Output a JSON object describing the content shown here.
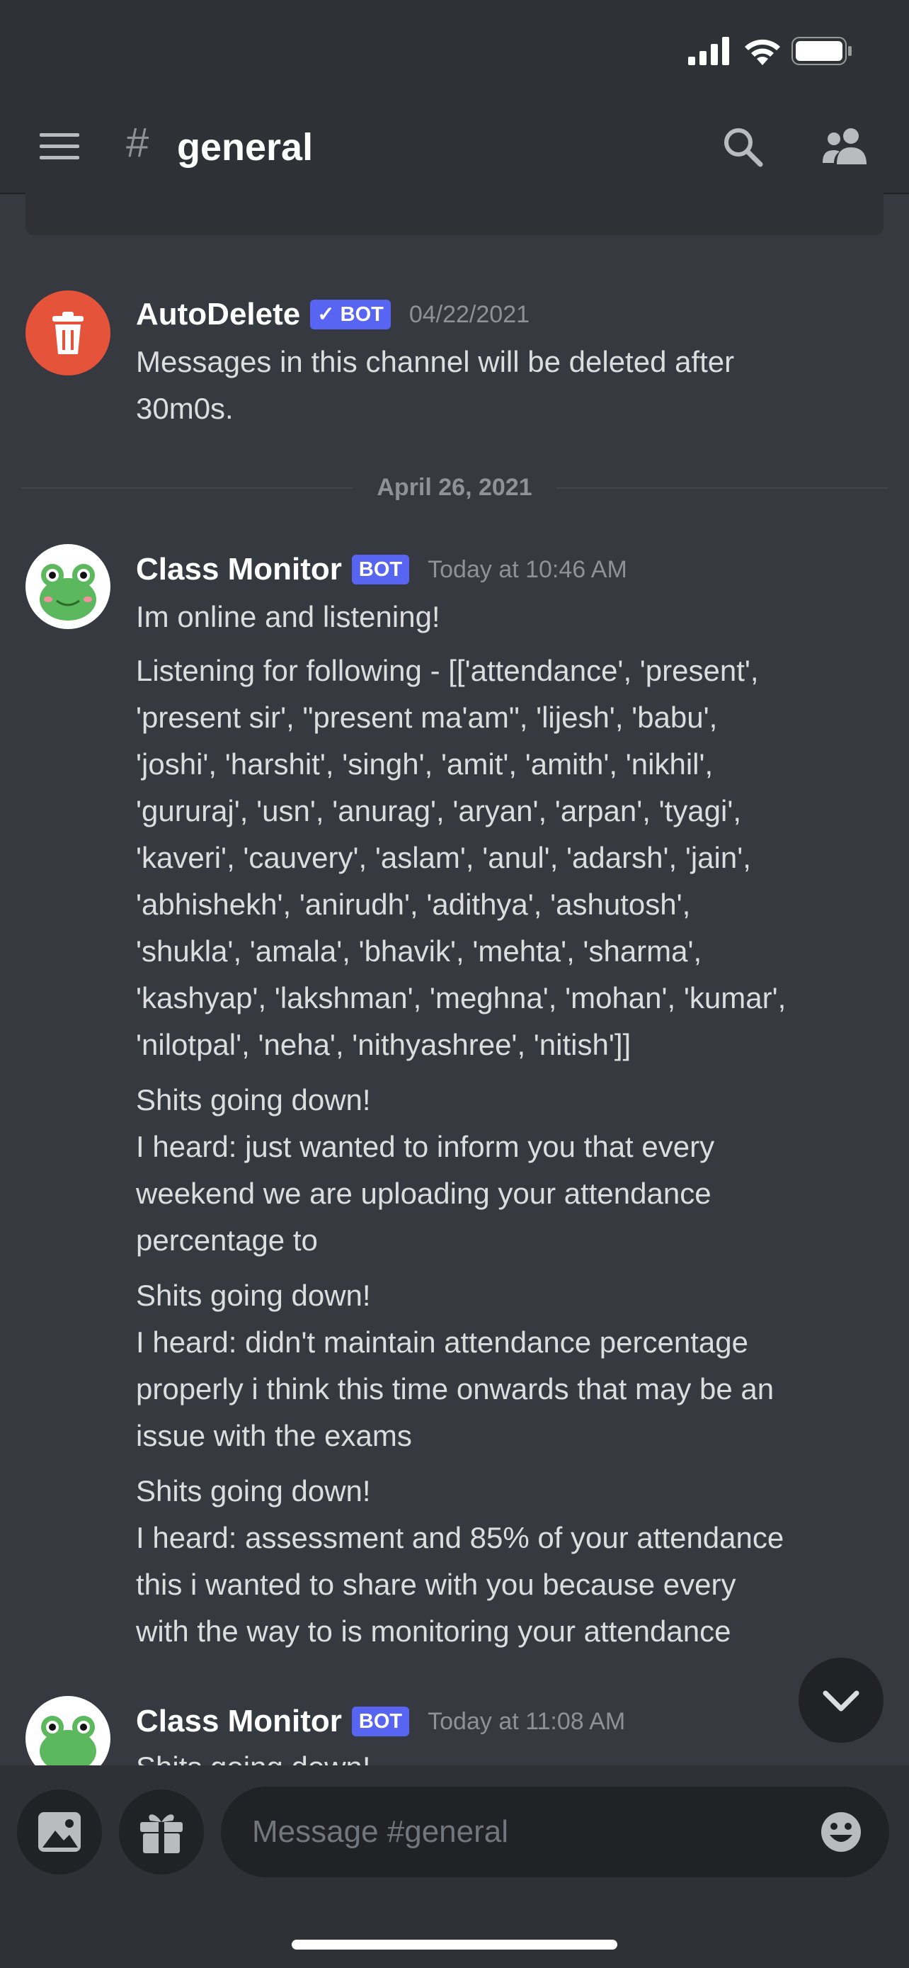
{
  "header": {
    "channel_name": "general",
    "hash_symbol": "#",
    "icons": [
      "hamburger-menu-icon",
      "search-icon",
      "members-icon"
    ]
  },
  "status_bar": {
    "icons": [
      "signal-icon",
      "wifi-icon",
      "battery-icon"
    ]
  },
  "messages": [
    {
      "author": "AutoDelete",
      "bot_tag": "BOT",
      "verified": true,
      "timestamp": "04/22/2021",
      "lines": [
        "Messages in this channel will be deleted after",
        "30m0s."
      ]
    }
  ],
  "date_divider": "April 26, 2021",
  "messages2": [
    {
      "author": "Class Monitor",
      "bot_tag": "BOT",
      "timestamp": "Today at 10:46 AM",
      "blocks": [
        [
          "Im online and listening!"
        ],
        [
          "Listening for following - [['attendance', 'present',",
          "'present sir', \"present ma'am\", 'lijesh', 'babu',",
          "'joshi', 'harshit', 'singh', 'amit', 'amith', 'nikhil',",
          "'gururaj', 'usn', 'anurag', 'aryan', 'arpan', 'tyagi',",
          "'kaveri', 'cauvery', 'aslam', 'anul', 'adarsh', 'jain',",
          "'abhishekh', 'anirudh', 'adithya', 'ashutosh',",
          "'shukla', 'amala', 'bhavik', 'mehta', 'sharma',",
          "'kashyap', 'lakshman', 'meghna', 'mohan', 'kumar',",
          "'nilotpal', 'neha', 'nithyashree', 'nitish']]"
        ],
        [
          "Shits going down!",
          "I heard: just wanted to inform you that every",
          "weekend we are uploading your attendance",
          "percentage to"
        ],
        [
          "Shits going down!",
          "I heard: didn't maintain attendance percentage",
          "properly i think this time onwards that may be an",
          "issue with the exams"
        ],
        [
          "Shits going down!",
          "I heard: assessment and 85% of your attendance",
          "this i wanted to share with you because every",
          "with the way to is monitoring your attendance"
        ]
      ]
    },
    {
      "author": "Class Monitor",
      "bot_tag": "BOT",
      "timestamp": "Today at 11:08 AM",
      "partial_line": "Shits going down!"
    }
  ],
  "composer": {
    "placeholder": "Message #general",
    "icons": [
      "image-icon",
      "gift-icon",
      "emoji-icon"
    ]
  },
  "colors": {
    "background": "#36393f",
    "header": "#2f3136",
    "bot_tag": "#5865f2",
    "autodelete_avatar": "#e4533a"
  }
}
